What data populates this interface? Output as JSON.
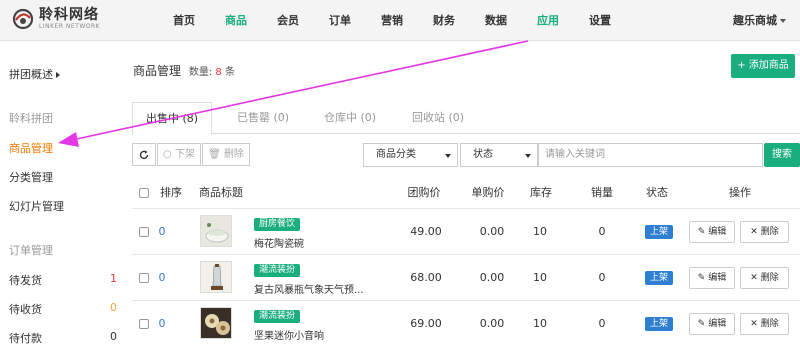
{
  "header": {
    "logo_cn": "聆科网络",
    "logo_en": "LINKER NETWORK",
    "nav": [
      {
        "label": "首页"
      },
      {
        "label": "商品"
      },
      {
        "label": "会员"
      },
      {
        "label": "订单"
      },
      {
        "label": "营销"
      },
      {
        "label": "财务"
      },
      {
        "label": "数据"
      },
      {
        "label": "应用"
      },
      {
        "label": "设置"
      }
    ],
    "shop_name": "趣乐商城"
  },
  "sidebar": {
    "items": [
      {
        "label": "拼团概述"
      },
      {
        "label": "聆科拼团"
      },
      {
        "label": "商品管理"
      },
      {
        "label": "分类管理"
      },
      {
        "label": "幻灯片管理"
      },
      {
        "label": "订单管理"
      },
      {
        "label": "待发货",
        "badge": "1"
      },
      {
        "label": "待收货",
        "badge": "0"
      },
      {
        "label": "待付款",
        "badge": "0"
      }
    ]
  },
  "main": {
    "title": "商品管理",
    "count_label": "数量:",
    "count_value": "8",
    "count_unit": "条",
    "add_button": "+ 添加商品",
    "tabs": [
      {
        "label": "出售中 (8)"
      },
      {
        "label": "已售罄 (0)"
      },
      {
        "label": "仓库中 (0)"
      },
      {
        "label": "回收站 (0)"
      }
    ],
    "toolbar": {
      "refresh_icon": "refresh-icon",
      "offshelf_label": "○ 下架",
      "delete_label": "🗑 删除",
      "category_select": "商品分类",
      "status_select": "状态",
      "search_placeholder": "请输入关键词",
      "search_button": "搜索"
    },
    "columns": [
      "排序",
      "商品标题",
      "团购价",
      "单购价",
      "库存",
      "销量",
      "状态",
      "操作"
    ],
    "rows": [
      {
        "sort": "0",
        "tag": "厨房餐饮",
        "name": "梅花陶瓷碗",
        "group_price": "49.00",
        "single_price": "0.00",
        "stock": "10",
        "sales": "0",
        "status": "上架",
        "edit": "编辑",
        "delete": "删除"
      },
      {
        "sort": "0",
        "tag": "潮流装扮",
        "name": "复古风暴瓶气象天气预...",
        "group_price": "68.00",
        "single_price": "0.00",
        "stock": "10",
        "sales": "0",
        "status": "上架",
        "edit": "编辑",
        "delete": "删除"
      },
      {
        "sort": "0",
        "tag": "潮流装扮",
        "name": "坚果迷你小音响",
        "group_price": "69.00",
        "single_price": "0.00",
        "stock": "10",
        "sales": "0",
        "status": "上架",
        "edit": "编辑",
        "delete": "删除"
      }
    ]
  },
  "colors": {
    "accent": "#1aad7e",
    "active_side": "#f07800",
    "status_blue": "#2e7fd1",
    "arrow": "#e535e5"
  }
}
